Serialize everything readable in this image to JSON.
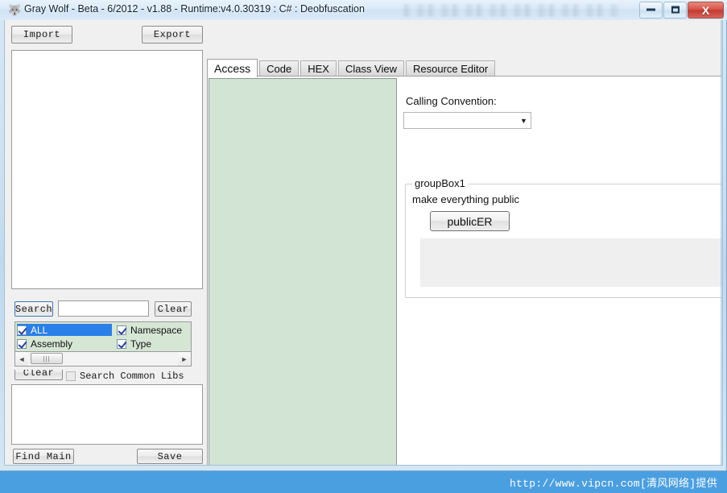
{
  "window": {
    "title": "Gray Wolf - Beta - 6/2012 - v1.88 - Runtime:v4.0.30319 : C# : Deobfuscation",
    "icon": "app-wolf-icon",
    "minimize_label": "",
    "maximize_label": "",
    "close_label": "X"
  },
  "left_panel": {
    "import_label": "Import",
    "export_label": "Export",
    "tree_items": [],
    "search_button_label": "Search",
    "search_input_value": "",
    "search_input_placeholder": "",
    "clear_button_label": "Clear",
    "filters": [
      {
        "label": "ALL",
        "checked": true,
        "selected": true
      },
      {
        "label": "Namespace",
        "checked": true,
        "selected": false
      },
      {
        "label": "Assembly",
        "checked": true,
        "selected": false
      },
      {
        "label": "Type",
        "checked": true,
        "selected": false
      }
    ],
    "hscroll": {
      "left_arrow": "◄",
      "right_arrow": "►",
      "thumb_grip": "|||"
    },
    "clear2_button_label": "Clear",
    "search_common_libs_label": "Search Common Libs",
    "search_common_libs_checked": false,
    "results_value": "",
    "find_main_label": "Find Main",
    "save_label": "Save"
  },
  "tabs": [
    {
      "label": "Access",
      "active": true
    },
    {
      "label": "Code",
      "active": false
    },
    {
      "label": "HEX",
      "active": false
    },
    {
      "label": "Class View",
      "active": false
    },
    {
      "label": "Resource Editor",
      "active": false
    }
  ],
  "access_tab": {
    "member_list_value": "",
    "calling_convention_label": "Calling Convention:",
    "calling_convention_value": "",
    "calling_convention_arrow": "▼",
    "groupbox_title": "groupBox1",
    "make_public_label": "make everything public",
    "public_button_label": "publicER",
    "log_value": ""
  },
  "statusbar": {
    "text": "http://www.vipcn.com[清风网络]提供"
  },
  "colors": {
    "accent": "#4a9fe0",
    "green_panel": "#d2e4d4",
    "checklist_bg": "#d5e6d5",
    "selection": "#2a7fe8",
    "close_button": "#c23a2f"
  }
}
